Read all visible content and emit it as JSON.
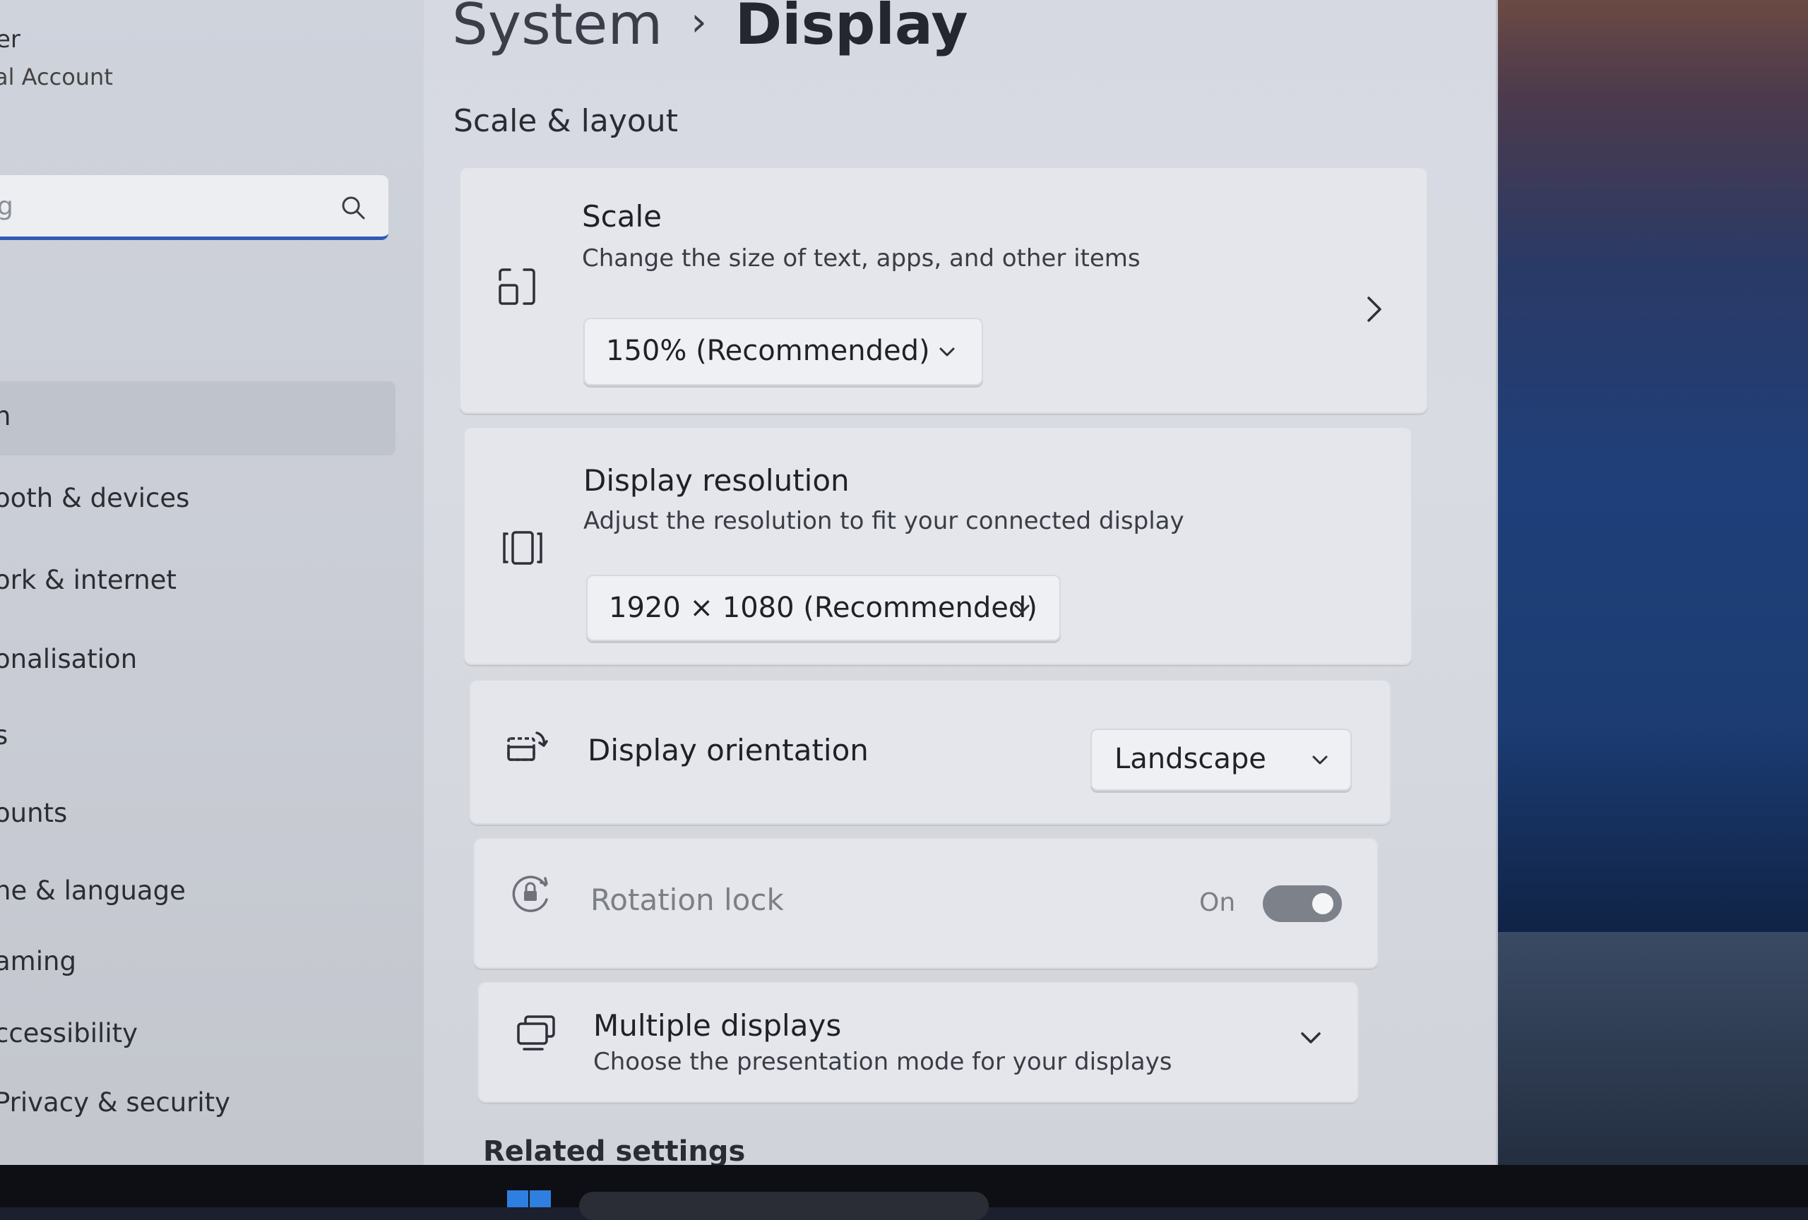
{
  "sidebar": {
    "user_name": "er",
    "user_sub": "al Account",
    "search_placeholder": "g",
    "active_item_label": "n",
    "items": [
      {
        "label": "ooth & devices"
      },
      {
        "label": "ork & internet"
      },
      {
        "label": "onalisation"
      },
      {
        "label": "s"
      },
      {
        "label": "ounts"
      },
      {
        "label": "ne & language"
      },
      {
        "label": "aming"
      },
      {
        "label": "ccessibility"
      },
      {
        "label": "Privacy & security"
      }
    ]
  },
  "header": {
    "breadcrumb_root": "System",
    "breadcrumb_separator": "›",
    "breadcrumb_current": "Display"
  },
  "section": {
    "title": "Scale & layout"
  },
  "cards": {
    "scale": {
      "title": "Scale",
      "description": "Change the size of text, apps, and other items",
      "value": "150% (Recommended)"
    },
    "resolution": {
      "title": "Display resolution",
      "description": "Adjust the resolution to fit your connected display",
      "value": "1920 × 1080 (Recommended)"
    },
    "orientation": {
      "title": "Display orientation",
      "value": "Landscape"
    },
    "rotation_lock": {
      "title": "Rotation lock",
      "state_label": "On",
      "enabled": false
    },
    "multiple_displays": {
      "title": "Multiple displays",
      "description": "Choose the presentation mode for your displays"
    }
  },
  "peek": {
    "heading": "Related settings"
  },
  "colors": {
    "accent": "#2f5bb8",
    "window_bg": "#d9dbe2",
    "card_bg": "#e4e6eb",
    "toggle_track": "#7d8189"
  },
  "icons": {
    "search": "search-icon",
    "scale": "scale-icon",
    "resolution": "resolution-icon",
    "orientation": "orientation-icon",
    "rotation_lock": "rotation-lock-icon",
    "multiple_displays": "multiple-displays-icon",
    "chevron_right": "chevron-right-icon",
    "chevron_down": "chevron-down-icon"
  }
}
